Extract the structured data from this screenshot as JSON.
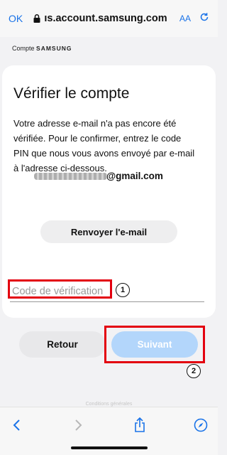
{
  "browser": {
    "ok_label": "OK",
    "url": "ıs.account.samsung.com",
    "text_size_label": "AA"
  },
  "brand": {
    "prefix": "Compte",
    "name": "SAMSUNG"
  },
  "page": {
    "title": "Vérifier le compte",
    "description": "Votre adresse e-mail n'a pas encore été vérifiée. Pour le confirmer, entrez le code PIN que nous vous avons envoyé par e-mail à l'adresse ci-dessous.",
    "email_domain": "@gmail.com",
    "resend_label": "Renvoyer l'e-mail",
    "code_placeholder": "Code de vérification"
  },
  "actions": {
    "back_label": "Retour",
    "next_label": "Suivant"
  },
  "annotations": {
    "marker_1": "1",
    "marker_2": "2",
    "highlight_color": "#e3000f"
  },
  "footer": {
    "faint_text": "Conditions générales"
  },
  "colors": {
    "accent": "#1a73e8",
    "next_button_disabled": "#b3d6fb"
  }
}
